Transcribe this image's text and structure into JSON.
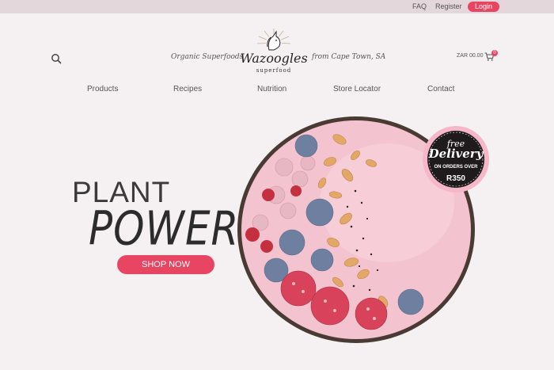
{
  "topbar": {
    "faq": "FAQ",
    "register": "Register",
    "login": "Login"
  },
  "header": {
    "tagline_left": "Organic Superfoods",
    "tagline_right": "from Cape Town, SA",
    "brand_name": "Wazoogles",
    "brand_sub": "superfood",
    "cart_total": "ZAR 00.00",
    "cart_count": "0"
  },
  "nav": {
    "items": [
      {
        "label": "Products"
      },
      {
        "label": "Recipes"
      },
      {
        "label": "Nutrition"
      },
      {
        "label": "Store Locator"
      },
      {
        "label": "Contact"
      }
    ]
  },
  "hero": {
    "line1": "PLANT",
    "line2": "POWER",
    "cta": "SHOP NOW"
  },
  "badge": {
    "line1": "free",
    "line2": "Delivery",
    "line3": "ON ORDERS OVER",
    "line4": "R350"
  },
  "colors": {
    "accent": "#e84563",
    "topbar": "#e3d7dc",
    "background": "#f5f1f3"
  },
  "icons": {
    "search": "search-icon",
    "cart": "cart-icon",
    "logo": "unicorn-logo"
  }
}
